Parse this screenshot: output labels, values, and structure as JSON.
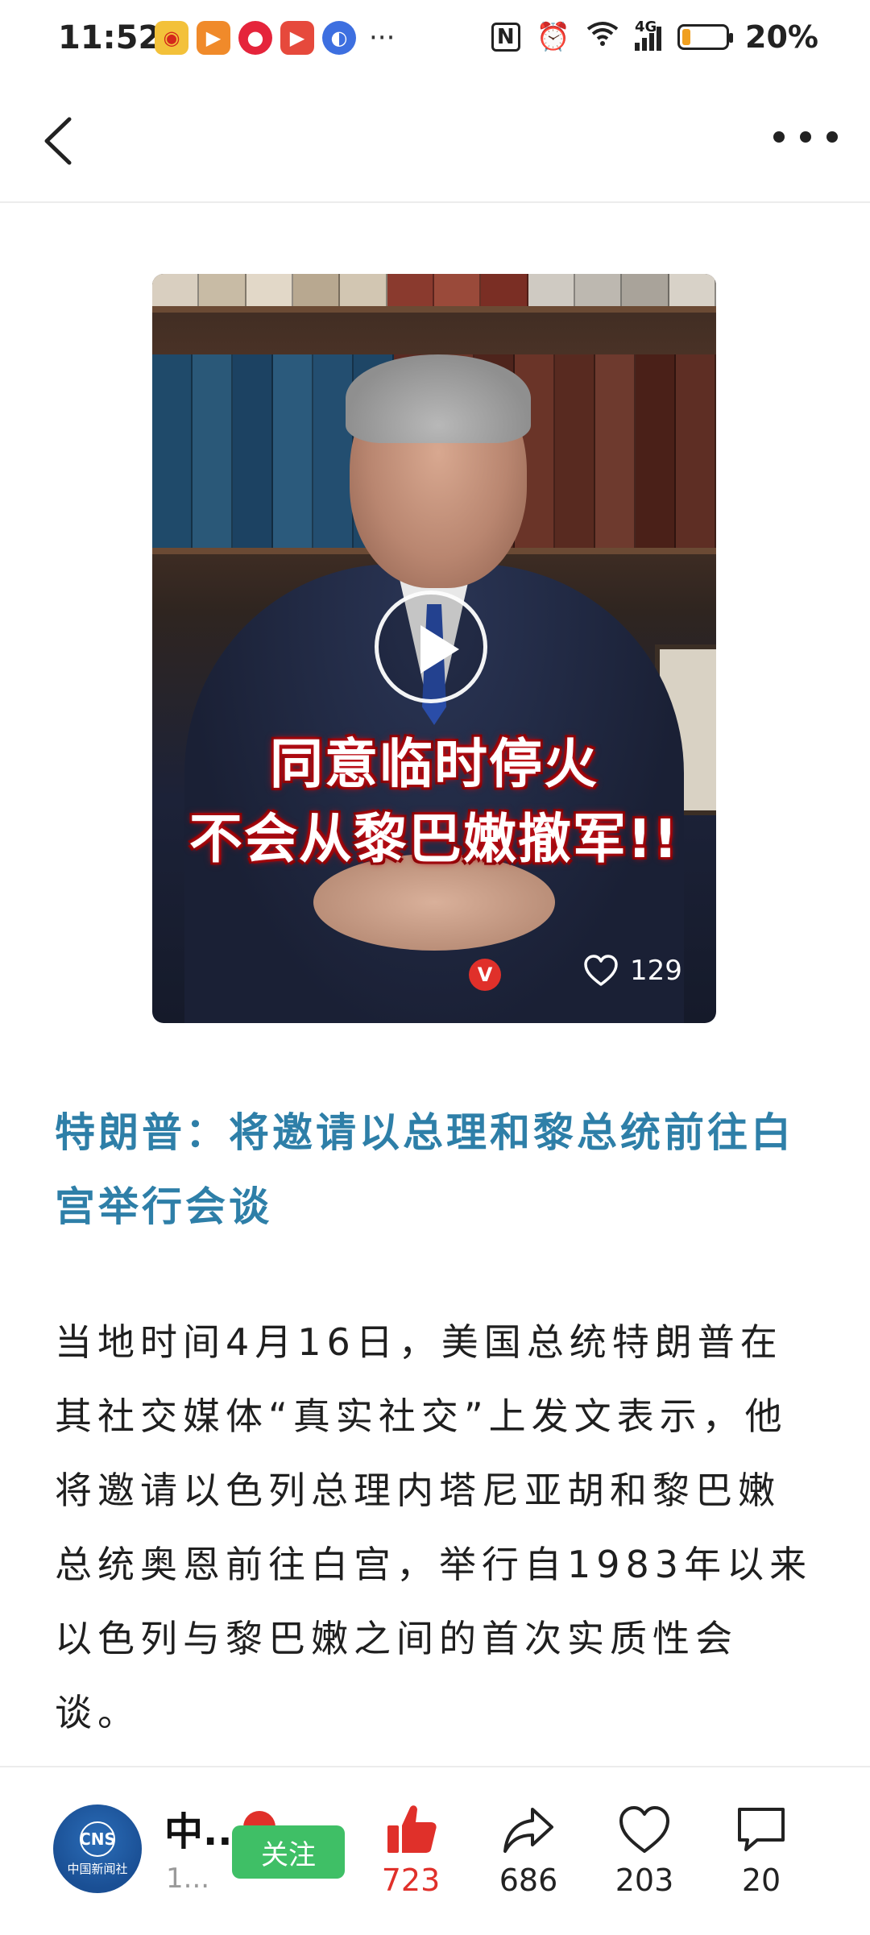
{
  "status_bar": {
    "time": "11:52",
    "app_icons": [
      "weibo-icon",
      "video-app-icon",
      "music-app-icon",
      "player-app-icon",
      "browser-app-icon"
    ],
    "more": "···",
    "nfc": "N",
    "network": "4G",
    "battery_percent": "20%",
    "battery_level": 0.2
  },
  "nav": {
    "back_icon": "chevron-left-icon",
    "more_icon": "more-horizontal-icon"
  },
  "video": {
    "caption_line1": "同意临时停火",
    "caption_line2": "不会从黎巴嫩撤军!!",
    "verified_badge": "V",
    "like_count": "129"
  },
  "article": {
    "headline": "特朗普：将邀请以总理和黎总统前往白宫举行会谈",
    "body": "当地时间4月16日，美国总统特朗普在其社交媒体“真实社交”上发文表示，他将邀请以色列总理内塔尼亚胡和黎巴嫩总统奥恩前往白宫，举行自1983年以来以色列与黎巴嫩之间的首次实质性会谈。"
  },
  "bottom_bar": {
    "avatar_logo": "CNS",
    "avatar_text": "中国新闻社",
    "author_name": "中..",
    "author_sub": "1...",
    "follow_label": "关注",
    "like_count": "723",
    "share_count": "686",
    "favorite_count": "203",
    "comment_count": "20",
    "accent_red": "#e0302a",
    "follow_green": "#3fbf66"
  }
}
